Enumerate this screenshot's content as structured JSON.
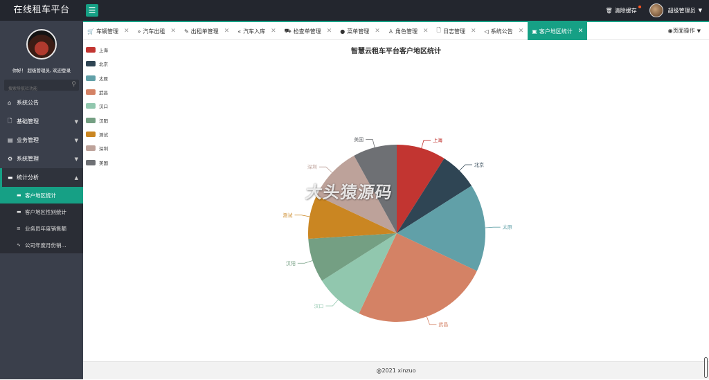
{
  "app": {
    "title": "在线租车平台"
  },
  "topbar": {
    "menu_icon": "hamburger-icon",
    "clear_cache": "清除缓存",
    "user": "超级管理员"
  },
  "sidebar": {
    "welcome": "你好！ 超级管理员, 欢迎登录",
    "search_placeholder": "搜索导航栏功能",
    "items": [
      {
        "label": "系统公告",
        "icon": "home-icon",
        "caret": ""
      },
      {
        "label": "基础管理",
        "icon": "file-icon",
        "caret": "▼"
      },
      {
        "label": "业务管理",
        "icon": "server-icon",
        "caret": "▼"
      },
      {
        "label": "系统管理",
        "icon": "gear-icon",
        "caret": "▼"
      },
      {
        "label": "统计分析",
        "icon": "monitor-icon",
        "caret": "▲"
      }
    ],
    "subitems": [
      {
        "label": "客户地区统计",
        "icon": "monitor-icon"
      },
      {
        "label": "客户地区性别统计",
        "icon": "monitor-icon"
      },
      {
        "label": "业务员年度销售额",
        "icon": "list-icon"
      },
      {
        "label": "公司年度月份销...",
        "icon": "pulse-icon"
      }
    ]
  },
  "tabs": [
    {
      "label": "车辆管理",
      "icon": "cart-icon"
    },
    {
      "label": "汽车出租",
      "icon": "forward-icon"
    },
    {
      "label": "出租单管理",
      "icon": "edit-icon"
    },
    {
      "label": "汽车入库",
      "icon": "backward-icon"
    },
    {
      "label": "检查单管理",
      "icon": "car-icon"
    },
    {
      "label": "菜单管理",
      "icon": "globe-icon"
    },
    {
      "label": "角色管理",
      "icon": "user-icon"
    },
    {
      "label": "日志管理",
      "icon": "file-icon"
    },
    {
      "label": "系统公告",
      "icon": "speaker-icon"
    },
    {
      "label": "客户地区统计",
      "icon": "monitor-icon"
    }
  ],
  "page_ops": "页面操作",
  "watermark": "大头猿源码",
  "footer": "@2021 xinzuo",
  "chart_data": {
    "type": "pie",
    "title": "智慧云租车平台客户地区统计",
    "categories": [
      "上海",
      "北京",
      "太原",
      "武昌",
      "汉口",
      "汉阳",
      "测试",
      "深圳",
      "美国"
    ],
    "values": [
      9,
      7,
      16,
      25,
      9,
      8,
      8,
      10,
      8
    ],
    "colors": [
      "#c23531",
      "#2f4554",
      "#61a0a8",
      "#d48265",
      "#91c7ae",
      "#749f83",
      "#ca8622",
      "#bda29a",
      "#6e7074"
    ],
    "legend_position": "top-left"
  }
}
